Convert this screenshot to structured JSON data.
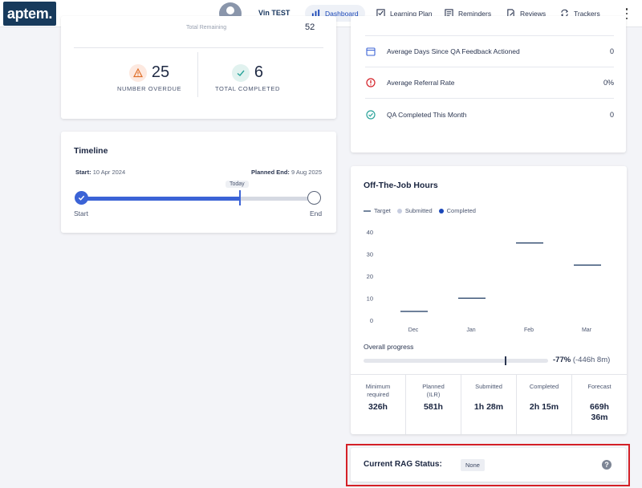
{
  "brand": {
    "logo_text": "aptem.",
    "color": "#173a5c"
  },
  "user": {
    "name": "Vin TEST"
  },
  "nav": {
    "items": [
      {
        "label": "Dashboard",
        "icon": "bar-chart-icon",
        "active": true
      },
      {
        "label": "Learning Plan",
        "icon": "checkbox-icon",
        "active": false
      },
      {
        "label": "Reminders",
        "icon": "list-icon",
        "active": false
      },
      {
        "label": "Reviews",
        "icon": "document-edit-icon",
        "active": false
      },
      {
        "label": "Trackers",
        "icon": "refresh-icon",
        "active": false
      }
    ]
  },
  "overview": {
    "truncated_label": "Total Remaining",
    "truncated_value": "52",
    "overdue": {
      "value": "25",
      "label": "NUMBER OVERDUE",
      "color": "#e0702a"
    },
    "completed": {
      "value": "6",
      "label": "TOTAL COMPLETED",
      "color": "#2aa39a"
    }
  },
  "timeline": {
    "title": "Timeline",
    "start_prefix": "Start:",
    "start_date": "10 Apr 2024",
    "end_prefix": "Planned End:",
    "end_date": "9 Aug 2025",
    "today_label": "Today",
    "start_label": "Start",
    "end_label": "End",
    "progress_fraction": 0.68
  },
  "metrics": [
    {
      "label": "Average Days Since QA Feedback Actioned",
      "value": "0",
      "icon": "calendar-icon",
      "color": "#3b63d6"
    },
    {
      "label": "Average Referral Rate",
      "value": "0%",
      "icon": "alert-circle-icon",
      "color": "#d42027"
    },
    {
      "label": "QA Completed This Month",
      "value": "0",
      "icon": "check-circle-icon",
      "color": "#2aa39a"
    }
  ],
  "otj": {
    "title": "Off-The-Job Hours",
    "legend": {
      "target": "Target",
      "submitted": "Submitted",
      "completed": "Completed"
    },
    "progress_label": "Overall progress",
    "progress_pct": "-77%",
    "progress_detail": "(-446h 8m)",
    "progress_fraction": 0.77,
    "summary": [
      {
        "label": "Minimum\nrequired",
        "value": "326h"
      },
      {
        "label": "Planned\n(ILR)",
        "value": "581h"
      },
      {
        "label": "Submitted",
        "value": "1h 28m"
      },
      {
        "label": "Completed",
        "value": "2h 15m"
      },
      {
        "label": "Forecast",
        "value": "669h\n36m"
      }
    ]
  },
  "chart_data": {
    "type": "bar",
    "categories": [
      "Dec",
      "Jan",
      "Feb",
      "Mar"
    ],
    "series": [
      {
        "name": "Target",
        "values": [
          4,
          10,
          35,
          25
        ]
      },
      {
        "name": "Submitted",
        "values": [
          0,
          0,
          0,
          0
        ]
      },
      {
        "name": "Completed",
        "values": [
          0,
          0,
          0,
          0
        ]
      }
    ],
    "ylim": [
      0,
      40
    ],
    "yticks": [
      0,
      10,
      20,
      30,
      40
    ],
    "grid": false,
    "legend_position": "top-left"
  },
  "rag": {
    "label": "Current RAG Status:",
    "value": "None"
  }
}
